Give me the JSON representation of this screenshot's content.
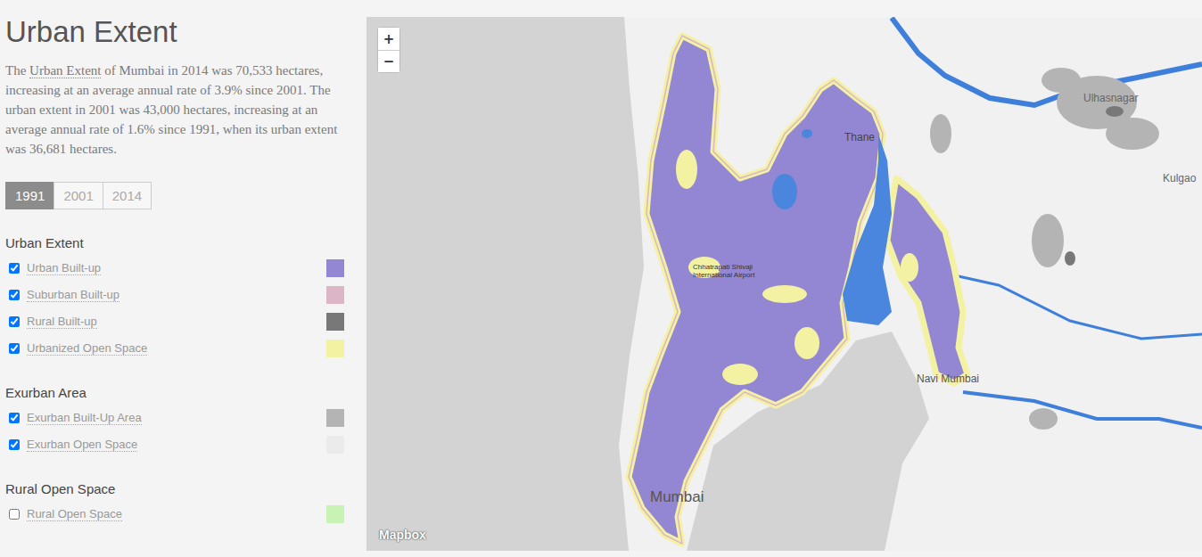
{
  "page": {
    "title": "Urban Extent",
    "intro_prefix": "The ",
    "intro_link": "Urban Extent",
    "intro_rest": " of Mumbai in 2014 was 70,533 hectares, increasing at an average annual rate of 3.9% since 2001. The urban extent in 2001 was 43,000 hectares, increasing at an average annual rate of 1.6% since 1991, when its urban extent was 36,681 hectares."
  },
  "tabs": [
    {
      "label": "1991",
      "selected": true
    },
    {
      "label": "2001",
      "selected": false
    },
    {
      "label": "2014",
      "selected": false
    }
  ],
  "legend": [
    {
      "heading": "Urban Extent",
      "items": [
        {
          "label": "Urban Built-up",
          "checked": true,
          "color": "#9386d3"
        },
        {
          "label": "Suburban Built-up",
          "checked": true,
          "color": "#dcb6c6"
        },
        {
          "label": "Rural Built-up",
          "checked": true,
          "color": "#787878"
        },
        {
          "label": "Urbanized Open Space",
          "checked": true,
          "color": "#f3f1a2"
        }
      ]
    },
    {
      "heading": "Exurban Area",
      "items": [
        {
          "label": "Exurban Built-Up Area",
          "checked": true,
          "color": "#b4b4b4"
        },
        {
          "label": "Exurban Open Space",
          "checked": true,
          "color": "#ebebeb"
        }
      ]
    },
    {
      "heading": "Rural Open Space",
      "items": [
        {
          "label": "Rural Open Space",
          "checked": false,
          "color": "#c9f3b4"
        }
      ]
    }
  ],
  "map": {
    "zoom_in": "+",
    "zoom_out": "−",
    "attribution": "Mapbox",
    "labels": [
      "Ulhasnagar",
      "Kulgao",
      "Thane",
      "Chhatrapati Shivaji International Airport",
      "Navi Mumbai",
      "Mumbai"
    ]
  }
}
